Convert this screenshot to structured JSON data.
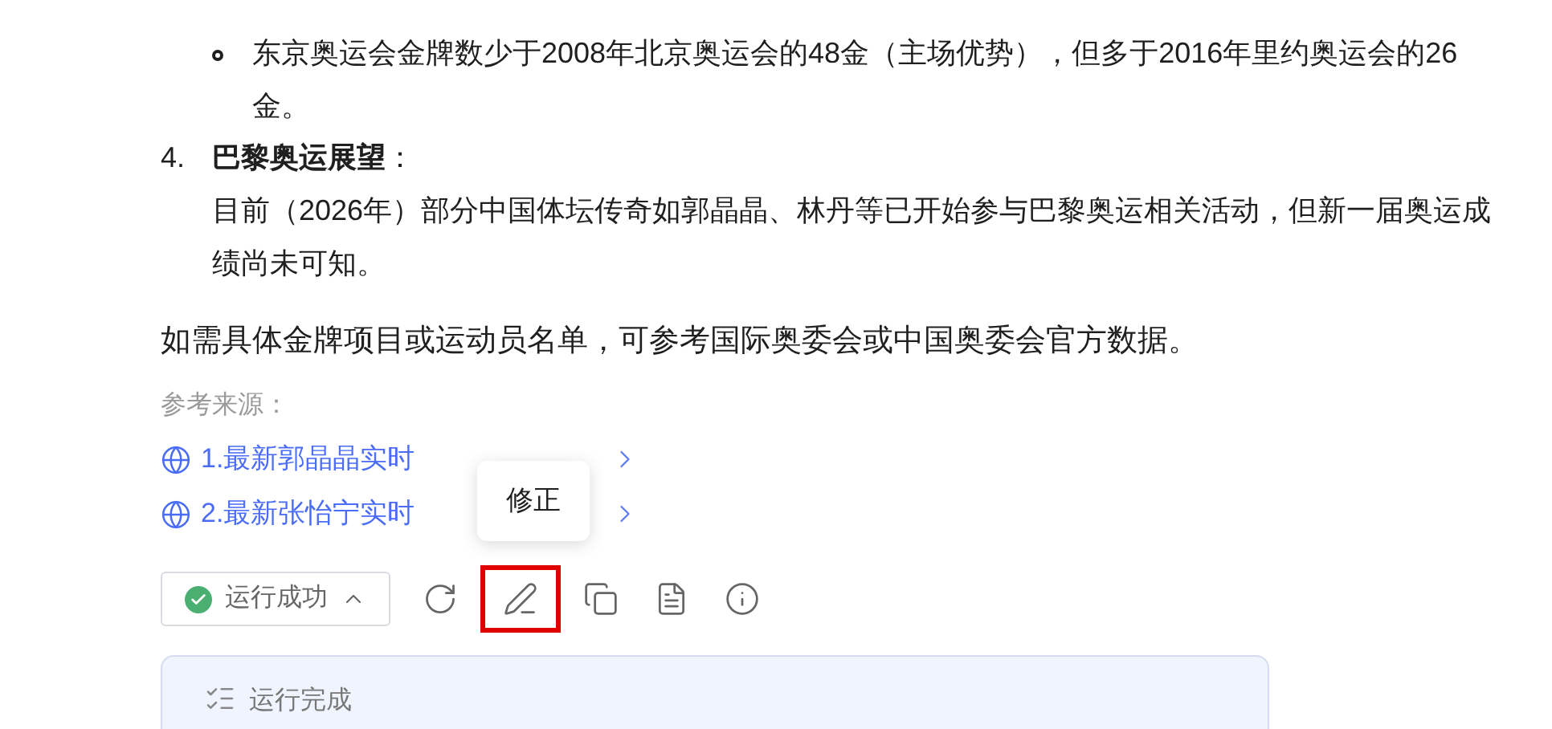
{
  "list_items": [
    {
      "bullets": [
        "东京奥运会金牌数少于2008年北京奥运会的48金（主场优势），但多于2016年里约奥运会的26金。"
      ]
    },
    {
      "number": "4.",
      "heading": "巴黎奥运展望",
      "heading_suffix": "：",
      "paragraph": "目前（2026年）部分中国体坛传奇如郭晶晶、林丹等已开始参与巴黎奥运相关活动，但新一届奥运成绩尚未可知。"
    }
  ],
  "closing": "如需具体金牌项目或运动员名单，可参考国际奥委会或中国奥委会官方数据。",
  "sources": {
    "label": "参考来源：",
    "links": [
      "1.最新郭晶晶实时",
      "2.最新张怡宁实时"
    ]
  },
  "tooltip": "修正",
  "status_button": {
    "label": "运行成功"
  },
  "toolbar": [
    {
      "kind": "refresh",
      "highlighted": false
    },
    {
      "kind": "edit",
      "highlighted": true
    },
    {
      "kind": "copy",
      "highlighted": false
    },
    {
      "kind": "notes",
      "highlighted": false
    },
    {
      "kind": "info",
      "highlighted": false
    }
  ],
  "panel": {
    "title": "运行完成"
  }
}
